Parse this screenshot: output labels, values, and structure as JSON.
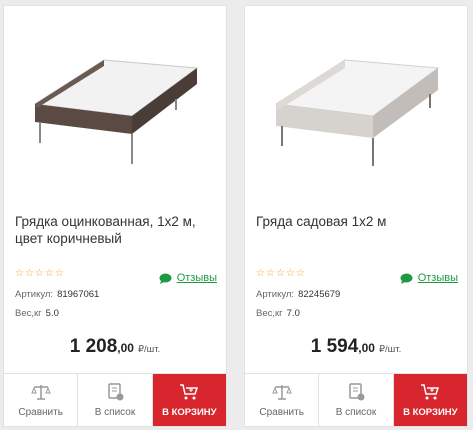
{
  "products": [
    {
      "title": "Грядка оцинкованная, 1х2 м, цвет коричневый",
      "stars": "☆☆☆☆☆",
      "reviews_label": "Отзывы",
      "article_label": "Артикул:",
      "article_value": "81967061",
      "weight_label": "Вес,кг",
      "weight_value": "5.0",
      "price_int": "1 208",
      "price_dec": ",00",
      "price_unit": "₽/шт.",
      "frame_color": "#5b4a43",
      "compare_label": "Сравнить",
      "list_label": "В список",
      "cart_label": "В КОРЗИНУ"
    },
    {
      "title": "Гряда садовая 1х2 м",
      "stars": "☆☆☆☆☆",
      "reviews_label": "Отзывы",
      "article_label": "Артикул:",
      "article_value": "82245679",
      "weight_label": "Вес,кг",
      "weight_value": "7.0",
      "price_int": "1 594",
      "price_dec": ",00",
      "price_unit": "₽/шт.",
      "frame_color": "#c9c4bf",
      "compare_label": "Сравнить",
      "list_label": "В список",
      "cart_label": "В КОРЗИНУ"
    }
  ],
  "colors": {
    "accent_red": "#d8262e",
    "reviews_green": "#1f9a43",
    "star_orange": "#f3a21c"
  },
  "icons": [
    "scales-icon",
    "list-doc-icon",
    "cart-plus-icon",
    "chat-bubble-icon"
  ]
}
